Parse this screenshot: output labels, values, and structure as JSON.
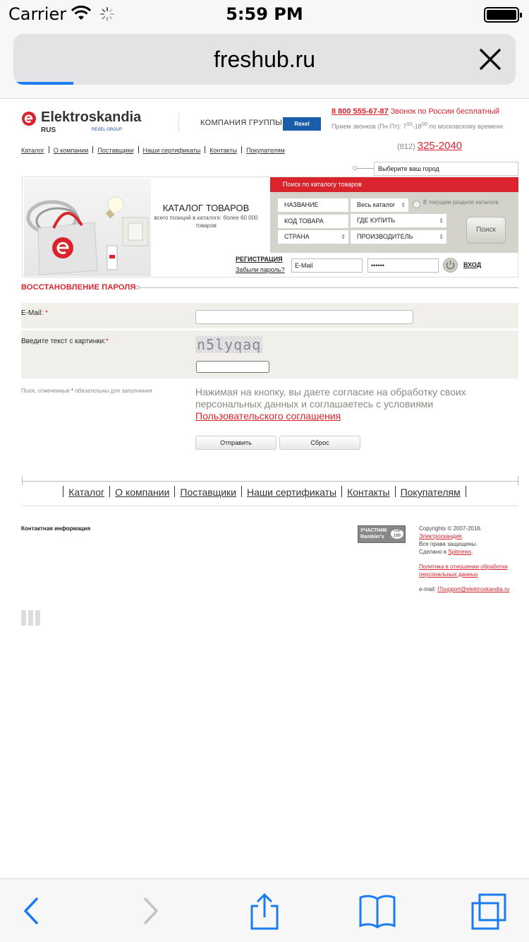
{
  "status_bar": {
    "carrier": "Carrier",
    "time": "5:59 PM"
  },
  "browser": {
    "url": "freshub.ru",
    "load_progress": 0.12,
    "accent": "#1a7cf0"
  },
  "header": {
    "logo_text": "Elektroskandia",
    "logo_sub": "RUS",
    "logo_group": "REXEL GROUP",
    "company_group": "КОМПАНИЯ  ГРУППЫ",
    "rexel": "Rexel",
    "phone_free_number": "8 800 555-67-87",
    "phone_free_text": " Звонок по России бесплатный",
    "phone_hours_prefix": "Прием звонков (Пн-Пт): 7",
    "phone_hours_from_sup": "00",
    "phone_hours_mid": "-18",
    "phone_hours_to_sup": "00",
    "phone_hours_suffix": " по московскому времени",
    "phone_local_code": "(812) ",
    "phone_local_number": "325-2040",
    "brand_color": "#d9232d"
  },
  "nav_top": [
    "Каталог",
    "О компании",
    "Поставщики",
    "Наши сертификаты",
    "Контакты",
    "Покупателям"
  ],
  "city_select": "Выберите ваш город",
  "catalog": {
    "title": "КАТАЛОГ ТОВАРОВ",
    "subtitle": "всего позиций в каталоге: более 60 000 товаров"
  },
  "search": {
    "header": "Поиск по каталогу товаров",
    "name": "НАЗВАНИЕ",
    "catalog_select": "Весь каталог",
    "in_section": "В текущем разделе каталога",
    "code": "КОД ТОВАРА",
    "where_buy": "ГДЕ КУПИТЬ",
    "country": "СТРАНА",
    "manufacturer": "ПРОИЗВОДИТЕЛЬ",
    "button": "Поиск"
  },
  "login": {
    "register": "РЕГИСТРАЦИЯ",
    "forgot": "Забыли пароль?",
    "email_value": "E-Mail",
    "password_value": "••••••",
    "login_button": "ВХОД"
  },
  "recovery": {
    "title": "ВОССТАНОВЛЕНИЕ ПАРОЛЯ",
    "email_label": "E-Mail:",
    "captcha_label": "Введите текст с картинки:",
    "captcha_text": "n5lyqaq",
    "required_note_a": "Поля, отмеченные ",
    "required_note_b": " обязательны для заполнения",
    "consent_text": "Нажимая на кнопку, вы даете согласие на обработку своих персональных данных и соглашаетесь с условиями ",
    "consent_link": "Пользовательского соглашения",
    "submit": "Отправить",
    "reset": "Сброс"
  },
  "footer": {
    "nav": [
      "Каталог",
      "О компании",
      "Поставщики",
      "Наши сертификаты",
      "Контакты",
      "Покупателям"
    ],
    "contact_info": "Контактная информация",
    "rambler_line1": "УЧАСТНИК",
    "rambler_line2": "Rambler's",
    "rambler_top": "TOP 100",
    "copyright": "Copyrights © 2007-2016.",
    "company_link": "Электроскандия",
    "rights": "Все права защищены.",
    "made_by": "Сделано в ",
    "made_by_link": "Spbnews",
    "policy_link": "Политика в отношении обработки персональных данных",
    "email_label": "e-mail: ",
    "email_link": "ITsupport@elektroskandia.ru"
  }
}
